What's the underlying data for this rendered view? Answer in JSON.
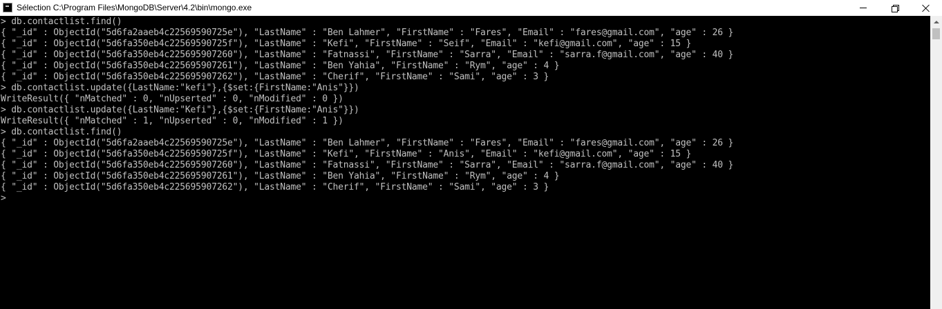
{
  "window": {
    "title": "Sélection C:\\Program Files\\MongoDB\\Server\\4.2\\bin\\mongo.exe",
    "icon": "console-app-icon"
  },
  "console": {
    "lines": [
      "> db.contactlist.find()",
      "{ \"_id\" : ObjectId(\"5d6fa2aaeb4c22569590725e\"), \"LastName\" : \"Ben Lahmer\", \"FirstName\" : \"Fares\", \"Email\" : \"fares@gmail.com\", \"age\" : 26 }",
      "{ \"_id\" : ObjectId(\"5d6fa350eb4c22569590725f\"), \"LastName\" : \"Kefi\", \"FirstName\" : \"Seif\", \"Email\" : \"kefi@gmail.com\", \"age\" : 15 }",
      "{ \"_id\" : ObjectId(\"5d6fa350eb4c225695907260\"), \"LastName\" : \"Fatnassi\", \"FirstName\" : \"Sarra\", \"Email\" : \"sarra.f@gmail.com\", \"age\" : 40 }",
      "{ \"_id\" : ObjectId(\"5d6fa350eb4c225695907261\"), \"LastName\" : \"Ben Yahia\", \"FirstName\" : \"Rym\", \"age\" : 4 }",
      "{ \"_id\" : ObjectId(\"5d6fa350eb4c225695907262\"), \"LastName\" : \"Cherif\", \"FirstName\" : \"Sami\", \"age\" : 3 }",
      "> db.contactlist.update({LastName:\"kefi\"},{$set:{FirstName:\"Anis\"}})",
      "WriteResult({ \"nMatched\" : 0, \"nUpserted\" : 0, \"nModified\" : 0 })",
      "> db.contactlist.update({LastName:\"Kefi\"},{$set:{FirstName:\"Anis\"}})",
      "WriteResult({ \"nMatched\" : 1, \"nUpserted\" : 0, \"nModified\" : 1 })",
      "> db.contactlist.find()",
      "{ \"_id\" : ObjectId(\"5d6fa2aaeb4c22569590725e\"), \"LastName\" : \"Ben Lahmer\", \"FirstName\" : \"Fares\", \"Email\" : \"fares@gmail.com\", \"age\" : 26 }",
      "{ \"_id\" : ObjectId(\"5d6fa350eb4c22569590725f\"), \"LastName\" : \"Kefi\", \"FirstName\" : \"Anis\", \"Email\" : \"kefi@gmail.com\", \"age\" : 15 }",
      "{ \"_id\" : ObjectId(\"5d6fa350eb4c225695907260\"), \"LastName\" : \"Fatnassi\", \"FirstName\" : \"Sarra\", \"Email\" : \"sarra.f@gmail.com\", \"age\" : 40 }",
      "{ \"_id\" : ObjectId(\"5d6fa350eb4c225695907261\"), \"LastName\" : \"Ben Yahia\", \"FirstName\" : \"Rym\", \"age\" : 4 }",
      "{ \"_id\" : ObjectId(\"5d6fa350eb4c225695907262\"), \"LastName\" : \"Cherif\", \"FirstName\" : \"Sami\", \"age\" : 3 }",
      ">"
    ]
  },
  "colors": {
    "console_background": "#000000",
    "console_text": "#c0c0c0",
    "titlebar_background": "#ffffff"
  },
  "icons": {
    "minimize": "minimize-icon",
    "maximize": "maximize-icon",
    "close": "close-icon",
    "scroll_up": "scroll-up-arrow-icon"
  }
}
